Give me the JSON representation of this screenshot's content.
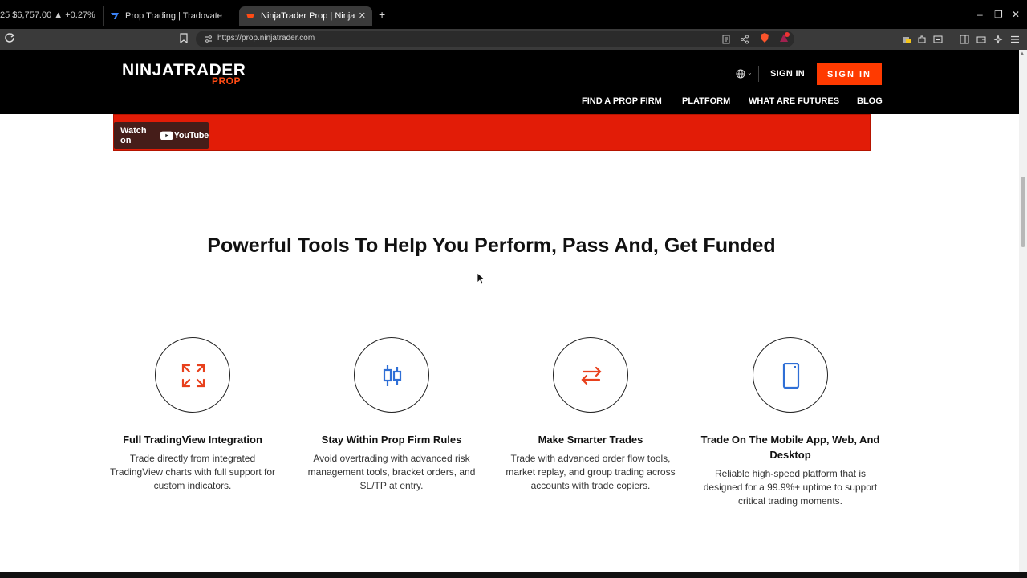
{
  "browser": {
    "ticker": "25 $6,757.00 ▲ +0.27%",
    "tabs": [
      {
        "title": "Prop Trading | Tradovate"
      },
      {
        "title": "NinjaTrader Prop | Ninja"
      }
    ],
    "url": "https://prop.ninjatrader.com"
  },
  "header": {
    "logo_main": "NINJATRADER",
    "logo_sub": "PROP",
    "sign_in_link": "SIGN IN",
    "sign_in_button": "SIGN IN",
    "nav": [
      "FIND A PROP FIRM",
      "PLATFORM",
      "WHAT ARE FUTURES",
      "BLOG"
    ]
  },
  "video": {
    "watch_on": "Watch on",
    "youtube": "YouTube"
  },
  "section": {
    "title": "Powerful Tools To Help You Perform, Pass And, Get Funded"
  },
  "features": [
    {
      "icon": "expand-arrows-icon",
      "title": "Full TradingView Integration",
      "desc": "Trade directly from integrated TradingView charts with full support for custom indicators."
    },
    {
      "icon": "candlestick-icon",
      "title": "Stay Within Prop Firm Rules",
      "desc": "Avoid overtrading with advanced risk management tools, bracket orders, and SL/TP at entry."
    },
    {
      "icon": "swap-arrows-icon",
      "title": "Make Smarter Trades",
      "desc": "Trade with advanced order flow tools, market replay, and group trading across accounts with trade copiers."
    },
    {
      "icon": "mobile-phone-icon",
      "title": "Trade On The Mobile App, Web, And Desktop",
      "desc": "Reliable high-speed platform that is designed for a 99.9%+ uptime to support critical trading moments."
    }
  ],
  "colors": {
    "brand_orange": "#ff3a00",
    "video_red": "#e21c07",
    "icon_red": "#e8401c",
    "icon_blue": "#2f6fd6"
  }
}
